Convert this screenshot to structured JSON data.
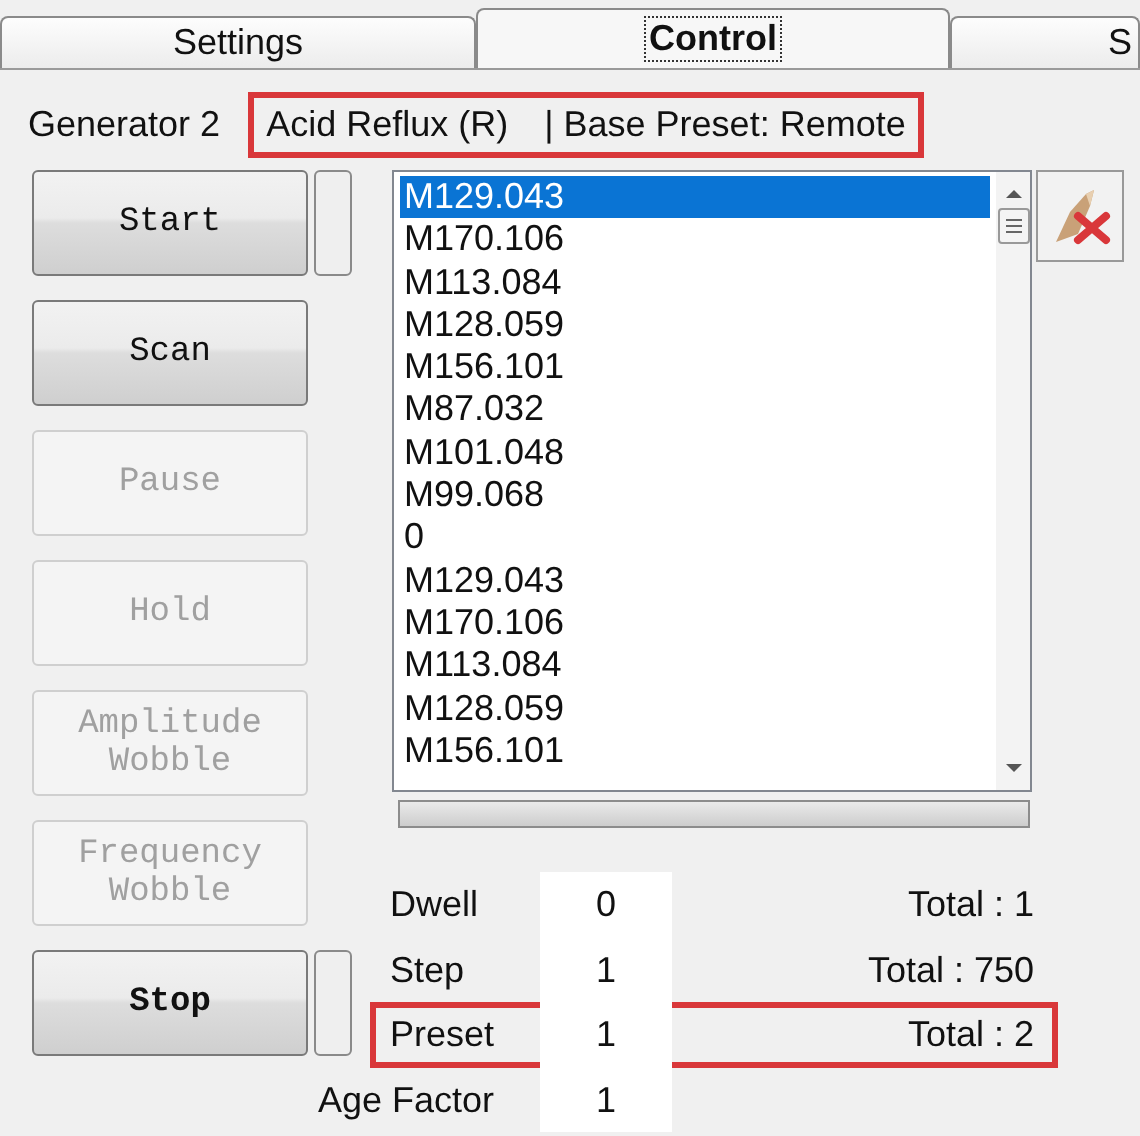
{
  "tabs": [
    {
      "label": "Settings",
      "selected": false
    },
    {
      "label": "Control",
      "selected": true
    },
    {
      "label": "S",
      "selected": false
    }
  ],
  "header": {
    "generator": "Generator 2",
    "program": "Acid Reflux (R)",
    "preset_info": "| Base Preset: Remote",
    "highlighted": true
  },
  "buttons": [
    {
      "label": "Start",
      "disabled": false,
      "indicator": true,
      "bold": false
    },
    {
      "label": "Scan",
      "disabled": false,
      "indicator": false,
      "bold": false
    },
    {
      "label": "Pause",
      "disabled": true,
      "indicator": false,
      "bold": false
    },
    {
      "label": "Hold",
      "disabled": true,
      "indicator": false,
      "bold": false
    },
    {
      "label": "Amplitude Wobble",
      "disabled": true,
      "indicator": false,
      "bold": false
    },
    {
      "label": "Frequency Wobble",
      "disabled": true,
      "indicator": false,
      "bold": false
    },
    {
      "label": "Stop",
      "disabled": false,
      "indicator": true,
      "bold": true
    }
  ],
  "list": [
    {
      "text": "M129.043",
      "selected": true
    },
    {
      "text": "M170.106",
      "selected": false
    },
    {
      "text": "M113.084",
      "selected": false
    },
    {
      "text": "M128.059",
      "selected": false
    },
    {
      "text": "M156.101",
      "selected": false
    },
    {
      "text": "M87.032",
      "selected": false
    },
    {
      "text": "M101.048",
      "selected": false
    },
    {
      "text": "M99.068",
      "selected": false
    },
    {
      "text": "0",
      "selected": false
    },
    {
      "text": "M129.043",
      "selected": false
    },
    {
      "text": "M170.106",
      "selected": false
    },
    {
      "text": "M113.084",
      "selected": false
    },
    {
      "text": "M128.059",
      "selected": false
    },
    {
      "text": "M156.101",
      "selected": false
    }
  ],
  "stats": [
    {
      "label": "Dwell",
      "value": "0",
      "total": "Total : 1",
      "highlighted": false
    },
    {
      "label": "Step",
      "value": "1",
      "total": "Total : 750",
      "highlighted": false
    },
    {
      "label": "Preset",
      "value": "1",
      "total": "Total : 2",
      "highlighted": true
    },
    {
      "label": "Age Factor",
      "value": "1",
      "highlighted": false
    }
  ]
}
